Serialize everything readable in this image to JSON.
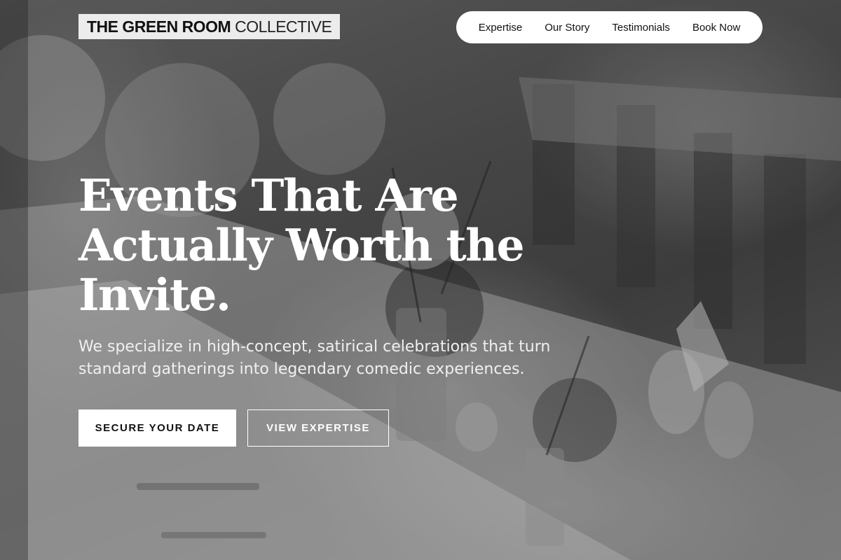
{
  "header": {
    "logo_strong": "THE GREEN ROOM",
    "logo_light": "COLLECTIVE"
  },
  "nav": {
    "items": [
      {
        "label": "Expertise"
      },
      {
        "label": "Our Story"
      },
      {
        "label": "Testimonials"
      },
      {
        "label": "Book Now"
      }
    ]
  },
  "hero": {
    "headline_line1": "Events That Are",
    "headline_line2": "Actually Worth the",
    "headline_line3": "Invite.",
    "subheadline": "We specialize in high-concept, satirical celebrations that turn standard gatherings into legendary comedic experiences.",
    "primary_cta": "SECURE YOUR DATE",
    "secondary_cta": "VIEW EXPERTISE",
    "background_image": "black-and-white-banquet-table-photo"
  },
  "colors": {
    "text_light": "#ffffff",
    "nav_bg": "#ffffff",
    "logo_bg": "#ececec",
    "text_dark": "#111111"
  }
}
